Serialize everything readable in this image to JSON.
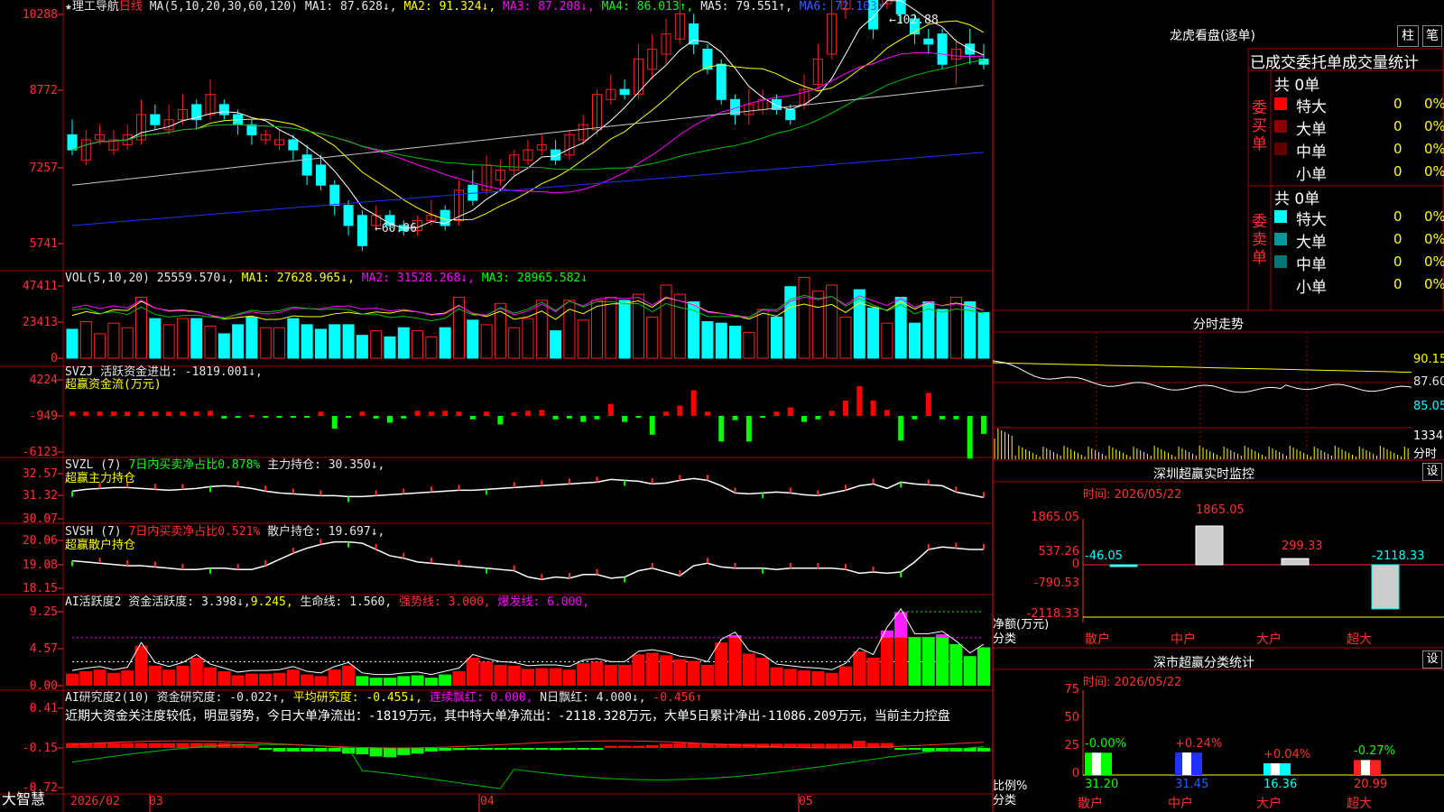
{
  "colors": {
    "bg": "#000000",
    "frame": "#aa0000",
    "up": "#ff2020",
    "down": "#00ffff",
    "ma1": "#ffffff",
    "ma2": "#ffff00",
    "ma3": "#ff00ff",
    "ma4": "#00c000",
    "ma5": "#c8c8c8",
    "ma6": "#2030ff"
  },
  "main_header": {
    "name": "理工导航",
    "period": "日线",
    "ma_params": "MA(5,10,20,30,60,120)",
    "ma1": "MA1: 87.628↓,",
    "ma2": "MA2: 91.324↓,",
    "ma3": "MA3: 87.208↓,",
    "ma4": "MA4: 86.013↑,",
    "ma5": "MA5: 79.551↑,",
    "ma6": "MA6: 72.103↑"
  },
  "price_axis": [
    "10288",
    "8772",
    "7257",
    "5741"
  ],
  "price_annotations": {
    "high": "102.88",
    "low": "60.06"
  },
  "vol": {
    "header": "VOL(5,10,20)",
    "value": "25559.570↓,",
    "ma1": "MA1: 27628.965↓,",
    "ma2": "MA2: 31528.268↓,",
    "ma3": "MA3: 28965.582↓",
    "axis": [
      "47411",
      "23413",
      "0"
    ]
  },
  "svzj": {
    "header": "SVZJ  活跃资金进出: -1819.001↓,",
    "sub": "超赢资金流(万元)",
    "axis": [
      "4224",
      "-949",
      "-6123"
    ]
  },
  "svzl": {
    "header": "SVZL (7)",
    "h2": "7日内买卖净占比0.878%",
    "h3": "主力持仓: 30.350↓,",
    "sub": "超赢主力持仓",
    "axis": [
      "32.57",
      "31.32",
      "30.07"
    ]
  },
  "svsh": {
    "header": "SVSH (7)",
    "h2": "7日内买卖净占比0.521%",
    "h3": "散户持仓: 19.697↓,",
    "sub": "超赢散户持仓",
    "axis": [
      "20.06",
      "19.08",
      "18.15"
    ]
  },
  "ai1": {
    "header": "AI活跃度2 资金活跃度: 3.398↓,",
    "h2": "9.245,",
    "h3": "生命线: 1.560,",
    "h4": "强势线: 3.000,",
    "h5": "爆发线: 6.000,",
    "axis": [
      "9.25",
      "4.57",
      "0.00"
    ]
  },
  "ai2": {
    "header": "AI研究度2(10) 资金研究度: -0.022↑,",
    "h2": "平均研究度: -0.455↓,",
    "h3": "连续飘红: 0.000,",
    "h4": "N日飘红: 4.000↓,",
    "h5": "-0.456↑",
    "text": "近期大资金关注度较低，明显弱势，今日大单净流出：-1819万元，其中特大单净流出：-2118.328万元，大单5日累计净出-11086.209万元，当前主力控盘",
    "axis": [
      "0.41",
      "-0.15",
      "-0.72"
    ]
  },
  "date_axis": {
    "brand": "大智慧",
    "labels": [
      "2026/02",
      "03",
      "04",
      "05"
    ]
  },
  "right": {
    "lhb_title": "龙虎看盘(逐单)",
    "btn1": "柱",
    "btn2": "笔",
    "tabs": [
      "已成交",
      "委托单",
      "成交量",
      "统计"
    ],
    "buy_label": "委买单",
    "sell_label": "委卖单",
    "buy_total": "共 0单",
    "sell_total": "共 0单",
    "buy_rows": [
      {
        "name": "特大",
        "n": "0",
        "p": "0%",
        "color": "#ff0000"
      },
      {
        "name": "大单",
        "n": "0",
        "p": "0%",
        "color": "#8b0000"
      },
      {
        "name": "中单",
        "n": "0",
        "p": "0%",
        "color": "#600000"
      },
      {
        "name": "小单",
        "n": "0",
        "p": "0%",
        "color": ""
      }
    ],
    "sell_rows": [
      {
        "name": "特大",
        "n": "0",
        "p": "0%",
        "color": "#00ffff"
      },
      {
        "name": "大单",
        "n": "0",
        "p": "0%",
        "color": "#009999"
      },
      {
        "name": "中单",
        "n": "0",
        "p": "0%",
        "color": "#007777"
      },
      {
        "name": "小单",
        "n": "0",
        "p": "0%",
        "color": ""
      }
    ],
    "intraday_title": "分时走势",
    "intraday_axis": [
      "90.15",
      "87.60",
      "85.05"
    ],
    "intraday_vol": "1334",
    "intraday_vol_label": "分时",
    "monitor_title": "深圳超赢实时监控",
    "monitor_time": "时间: 2026/05/22",
    "monitor_axis": [
      "1865.05",
      "537.26",
      "0",
      "-790.53",
      "-2118.33"
    ],
    "monitor_unit": "净额(万元)",
    "monitor_class": "分类",
    "monitor_bars": [
      {
        "cat": "散户",
        "val": "-46.05"
      },
      {
        "cat": "中户",
        "val": "1865.05"
      },
      {
        "cat": "大户",
        "val": "299.33"
      },
      {
        "cat": "超大",
        "val": "-2118.33"
      }
    ],
    "stats_title": "深市超赢分类统计",
    "stats_time": "时间: 2026/05/22",
    "stats_axis": [
      "75",
      "50",
      "25",
      "0"
    ],
    "stats_unit": "比例%",
    "stats_class": "分类",
    "stats_bars": [
      {
        "cat": "散户",
        "pct": "-0.00%",
        "val": "31.20"
      },
      {
        "cat": "中户",
        "pct": "+0.24%",
        "val": "31.45"
      },
      {
        "cat": "大户",
        "pct": "+0.04%",
        "val": "16.36"
      },
      {
        "cat": "超大",
        "pct": "-0.27%",
        "val": "20.99"
      }
    ],
    "set_btn": "设"
  },
  "chart_data": {
    "type": "candlestick",
    "price_axis_labels": [
      "10288",
      "8772",
      "7257",
      "5741"
    ],
    "candles_ohlc": [
      [
        7.9,
        7.6,
        8.2,
        7.5
      ],
      [
        7.4,
        7.8,
        8.0,
        7.3
      ],
      [
        7.8,
        7.9,
        8.1,
        7.7
      ],
      [
        7.6,
        7.8,
        8.0,
        7.5
      ],
      [
        7.7,
        7.9,
        8.1,
        7.6
      ],
      [
        7.8,
        8.3,
        8.6,
        7.7
      ],
      [
        8.3,
        8.1,
        8.5,
        8.0
      ],
      [
        8.0,
        8.2,
        8.5,
        7.9
      ],
      [
        8.2,
        8.4,
        8.7,
        8.1
      ],
      [
        8.5,
        8.2,
        8.6,
        8.0
      ],
      [
        8.3,
        8.7,
        9.0,
        8.2
      ],
      [
        8.5,
        8.3,
        8.6,
        8.2
      ],
      [
        8.3,
        8.1,
        8.4,
        7.9
      ],
      [
        8.1,
        7.9,
        8.2,
        7.7
      ],
      [
        7.8,
        7.9,
        8.0,
        7.7
      ],
      [
        7.7,
        7.8,
        8.0,
        7.6
      ],
      [
        7.8,
        7.6,
        7.9,
        7.4
      ],
      [
        7.5,
        7.1,
        7.7,
        6.9
      ],
      [
        7.3,
        6.9,
        7.5,
        6.8
      ],
      [
        6.9,
        6.5,
        7.0,
        6.3
      ],
      [
        6.5,
        6.1,
        6.6,
        5.9
      ],
      [
        6.3,
        5.7,
        6.4,
        5.6
      ],
      [
        6.1,
        6.3,
        6.5,
        6.0
      ],
      [
        6.3,
        6.1,
        6.4,
        6.0
      ],
      [
        6.1,
        6.0,
        6.2,
        5.9
      ],
      [
        6.0,
        6.2,
        6.3,
        5.9
      ],
      [
        6.2,
        6.3,
        6.6,
        6.1
      ],
      [
        6.4,
        6.1,
        6.5,
        6.0
      ],
      [
        6.2,
        6.8,
        7.0,
        6.1
      ],
      [
        6.9,
        6.6,
        7.2,
        6.5
      ],
      [
        6.8,
        7.3,
        7.5,
        6.7
      ],
      [
        7.0,
        7.2,
        7.4,
        6.9
      ],
      [
        7.2,
        7.5,
        7.6,
        7.1
      ],
      [
        7.4,
        7.6,
        7.8,
        7.3
      ],
      [
        7.6,
        7.7,
        7.9,
        7.5
      ],
      [
        7.6,
        7.4,
        7.8,
        7.3
      ],
      [
        7.5,
        7.9,
        8.0,
        7.4
      ],
      [
        7.8,
        8.1,
        8.3,
        7.7
      ],
      [
        8.0,
        8.7,
        8.8,
        7.9
      ],
      [
        8.6,
        8.8,
        9.1,
        8.5
      ],
      [
        8.8,
        8.7,
        9.0,
        8.6
      ],
      [
        8.7,
        9.4,
        9.7,
        8.6
      ],
      [
        9.2,
        9.6,
        9.9,
        9.0
      ],
      [
        9.5,
        9.9,
        10.2,
        9.3
      ],
      [
        9.8,
        10.3,
        10.6,
        9.7
      ],
      [
        10.1,
        9.7,
        10.3,
        9.5
      ],
      [
        9.6,
        9.2,
        9.7,
        9.1
      ],
      [
        9.3,
        8.6,
        9.4,
        8.5
      ],
      [
        8.6,
        8.3,
        8.7,
        8.1
      ],
      [
        8.3,
        8.5,
        8.8,
        8.1
      ],
      [
        8.4,
        8.6,
        8.8,
        8.3
      ],
      [
        8.6,
        8.4,
        8.7,
        8.3
      ],
      [
        8.4,
        8.2,
        8.5,
        8.1
      ],
      [
        8.5,
        8.8,
        9.1,
        8.4
      ],
      [
        8.9,
        9.4,
        9.7,
        8.8
      ],
      [
        9.5,
        10.3,
        10.7,
        9.4
      ],
      [
        10.4,
        10.8,
        11.1,
        10.2
      ],
      [
        10.9,
        10.7,
        11.2,
        10.6
      ],
      [
        10.6,
        10.0,
        10.9,
        9.8
      ],
      [
        10.5,
        11.0,
        11.3,
        10.4
      ],
      [
        11.0,
        10.3,
        11.2,
        10.1
      ],
      [
        10.2,
        9.9,
        10.3,
        9.7
      ],
      [
        9.8,
        9.7,
        10.0,
        9.5
      ],
      [
        9.9,
        9.3,
        10.0,
        9.2
      ],
      [
        9.4,
        9.6,
        9.8,
        8.9
      ],
      [
        9.7,
        9.5,
        10.0,
        9.3
      ],
      [
        9.4,
        9.3,
        9.7,
        9.2
      ]
    ],
    "ma_series": [
      "MA1",
      "MA2",
      "MA3",
      "MA4",
      "MA5",
      "MA6"
    ],
    "vol_axis_labels": [
      "47411",
      "23413",
      "0"
    ],
    "svzj_axis_labels": [
      "4224",
      "-949",
      "-6123"
    ]
  }
}
